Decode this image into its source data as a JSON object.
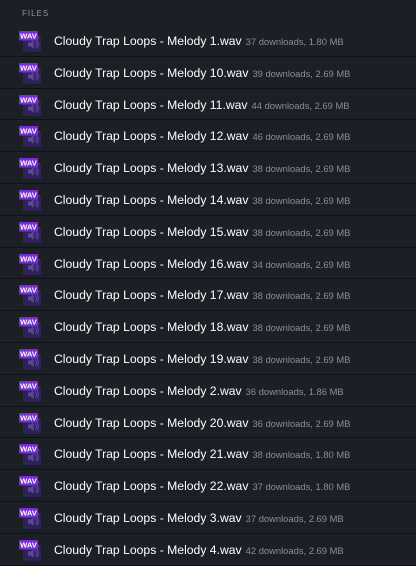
{
  "section_label": "FILES",
  "icon": {
    "name": "wav-file-icon",
    "badge": "WAV",
    "badge_color": "#7b2cd6",
    "doc_color": "#2d2254"
  },
  "files": [
    {
      "name": "Cloudy Trap Loops - Melody 1.wav",
      "meta": "37 downloads, 1.80 MB"
    },
    {
      "name": "Cloudy Trap Loops - Melody 10.wav",
      "meta": "39 downloads, 2.69 MB"
    },
    {
      "name": "Cloudy Trap Loops - Melody 11.wav",
      "meta": "44 downloads, 2.69 MB"
    },
    {
      "name": "Cloudy Trap Loops - Melody 12.wav",
      "meta": "46 downloads, 2.69 MB"
    },
    {
      "name": "Cloudy Trap Loops - Melody 13.wav",
      "meta": "38 downloads, 2.69 MB"
    },
    {
      "name": "Cloudy Trap Loops - Melody 14.wav",
      "meta": "38 downloads, 2.69 MB"
    },
    {
      "name": "Cloudy Trap Loops - Melody 15.wav",
      "meta": "38 downloads, 2.69 MB"
    },
    {
      "name": "Cloudy Trap Loops - Melody 16.wav",
      "meta": "34 downloads, 2.69 MB"
    },
    {
      "name": "Cloudy Trap Loops - Melody 17.wav",
      "meta": "38 downloads, 2.69 MB"
    },
    {
      "name": "Cloudy Trap Loops - Melody 18.wav",
      "meta": "38 downloads, 2.69 MB"
    },
    {
      "name": "Cloudy Trap Loops - Melody 19.wav",
      "meta": "38 downloads, 2.69 MB"
    },
    {
      "name": "Cloudy Trap Loops - Melody 2.wav",
      "meta": "36 downloads, 1.86 MB"
    },
    {
      "name": "Cloudy Trap Loops - Melody 20.wav",
      "meta": "36 downloads, 2.69 MB"
    },
    {
      "name": "Cloudy Trap Loops - Melody 21.wav",
      "meta": "38 downloads, 1.80 MB"
    },
    {
      "name": "Cloudy Trap Loops - Melody 22.wav",
      "meta": "37 downloads, 1.80 MB"
    },
    {
      "name": "Cloudy Trap Loops - Melody 3.wav",
      "meta": "37 downloads, 2.69 MB"
    },
    {
      "name": "Cloudy Trap Loops - Melody 4.wav",
      "meta": "42 downloads, 2.69 MB"
    }
  ]
}
